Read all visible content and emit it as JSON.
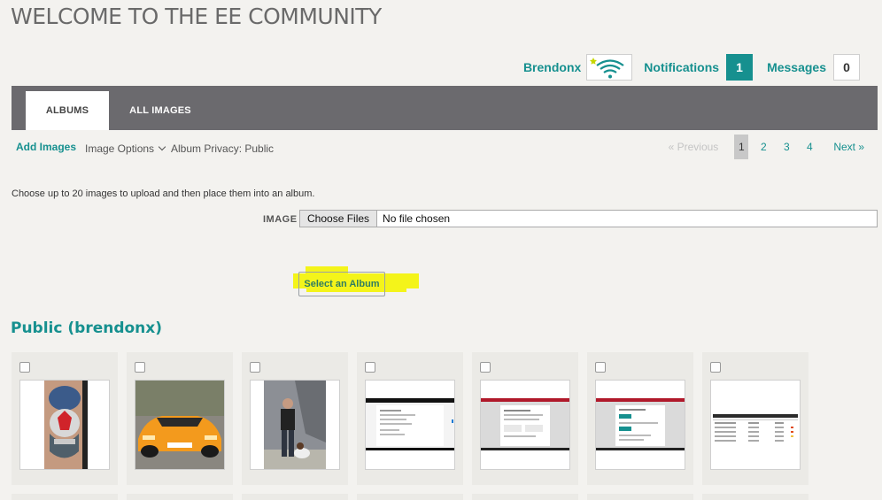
{
  "site": {
    "title": "WELCOME TO THE EE COMMUNITY"
  },
  "user": {
    "name": "Brendonx",
    "avatar_icon": "wifi-logo-icon"
  },
  "notifications": {
    "label": "Notifications",
    "count": "1"
  },
  "messages": {
    "label": "Messages",
    "count": "0"
  },
  "tabs": [
    {
      "label": "ALBUMS",
      "active": true
    },
    {
      "label": "ALL IMAGES",
      "active": false
    }
  ],
  "toolbar": {
    "add_images": "Add Images",
    "image_options": "Image Options",
    "album_privacy": "Album Privacy: Public"
  },
  "pagination": {
    "previous": "« Previous",
    "pages": [
      "1",
      "2",
      "3",
      "4"
    ],
    "current": "1",
    "next": "Next »"
  },
  "upload": {
    "instructions": "Choose up to 20 images to upload and then place them into an album.",
    "image_label": "IMAGE",
    "choose_files": "Choose Files",
    "no_file": "No file chosen",
    "select_album": "Select an Album"
  },
  "album": {
    "title": "Public (brendonx)"
  },
  "colors": {
    "accent": "#16908f",
    "tabbar": "#6b6a6e",
    "highlight": "#f4f41a"
  },
  "thumbnails": [
    {
      "name": "tattoo-photo"
    },
    {
      "name": "orange-sports-car-photo"
    },
    {
      "name": "man-with-dog-photo"
    },
    {
      "name": "webpage-screenshot-1"
    },
    {
      "name": "webpage-screenshot-2"
    },
    {
      "name": "webpage-screenshot-3"
    },
    {
      "name": "table-screenshot"
    }
  ]
}
